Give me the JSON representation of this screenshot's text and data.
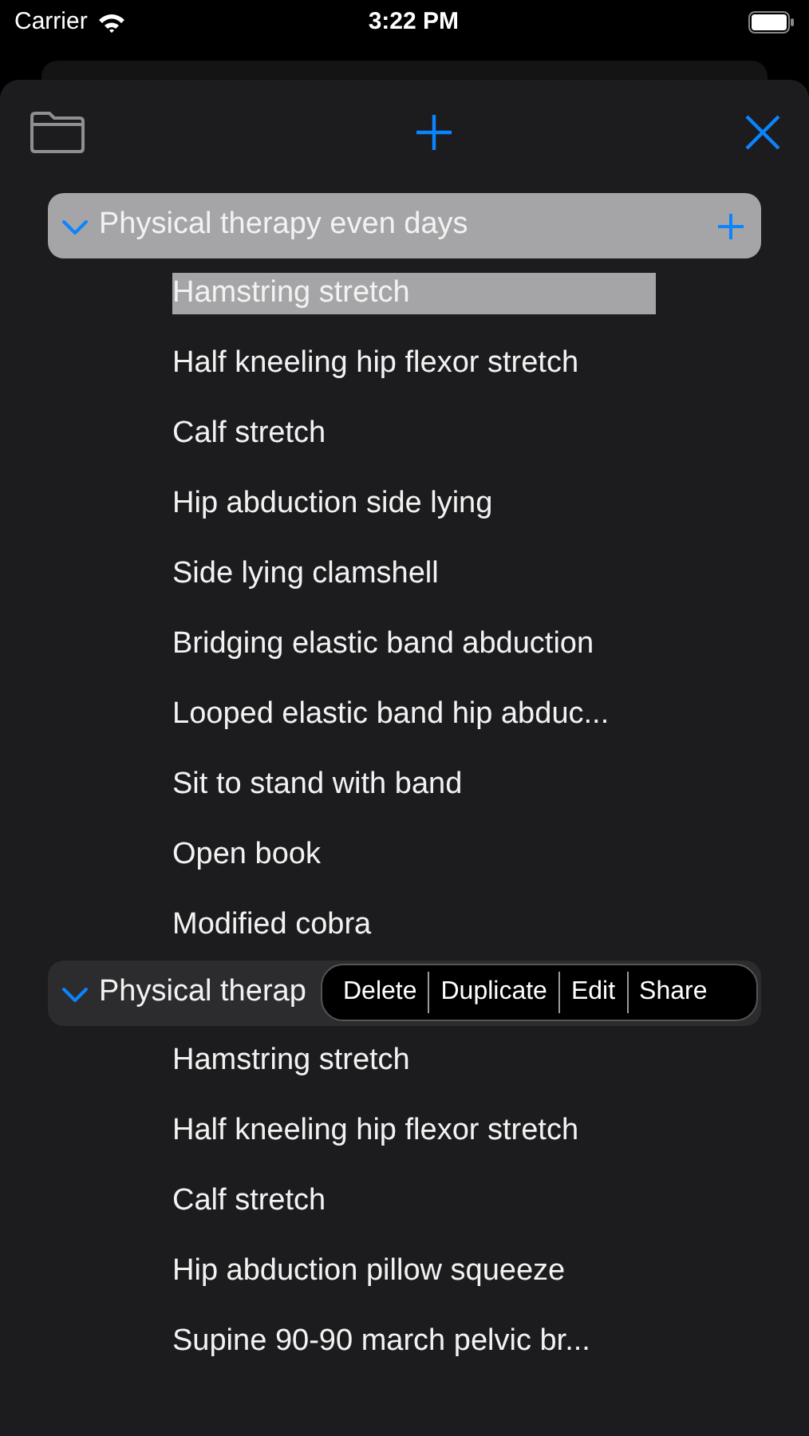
{
  "status_bar": {
    "carrier": "Carrier",
    "time": "3:22 PM"
  },
  "groups": [
    {
      "title": "Physical therapy even days",
      "expanded": true,
      "selected": true,
      "add_button": true,
      "items": [
        {
          "label": "Hamstring stretch",
          "selected": true
        },
        {
          "label": "Half kneeling hip flexor stretch",
          "selected": false
        },
        {
          "label": "Calf stretch",
          "selected": false
        },
        {
          "label": "Hip abduction side lying",
          "selected": false
        },
        {
          "label": "Side lying clamshell",
          "selected": false
        },
        {
          "label": "Bridging elastic band abduction",
          "selected": false
        },
        {
          "label": "Looped elastic band hip abduc...",
          "selected": false
        },
        {
          "label": "Sit to stand with band",
          "selected": false
        },
        {
          "label": "Open book",
          "selected": false
        },
        {
          "label": "Modified cobra",
          "selected": false
        }
      ]
    },
    {
      "title": "Physical therap",
      "expanded": true,
      "selected": false,
      "add_button": false,
      "context_menu": [
        "Delete",
        "Duplicate",
        "Edit",
        "Share"
      ],
      "items": [
        {
          "label": "Hamstring stretch",
          "selected": false
        },
        {
          "label": "Half kneeling hip flexor stretch",
          "selected": false
        },
        {
          "label": "Calf stretch",
          "selected": false
        },
        {
          "label": "Hip abduction pillow squeeze",
          "selected": false
        },
        {
          "label": "Supine 90-90 march pelvic br...",
          "selected": false
        }
      ]
    }
  ]
}
